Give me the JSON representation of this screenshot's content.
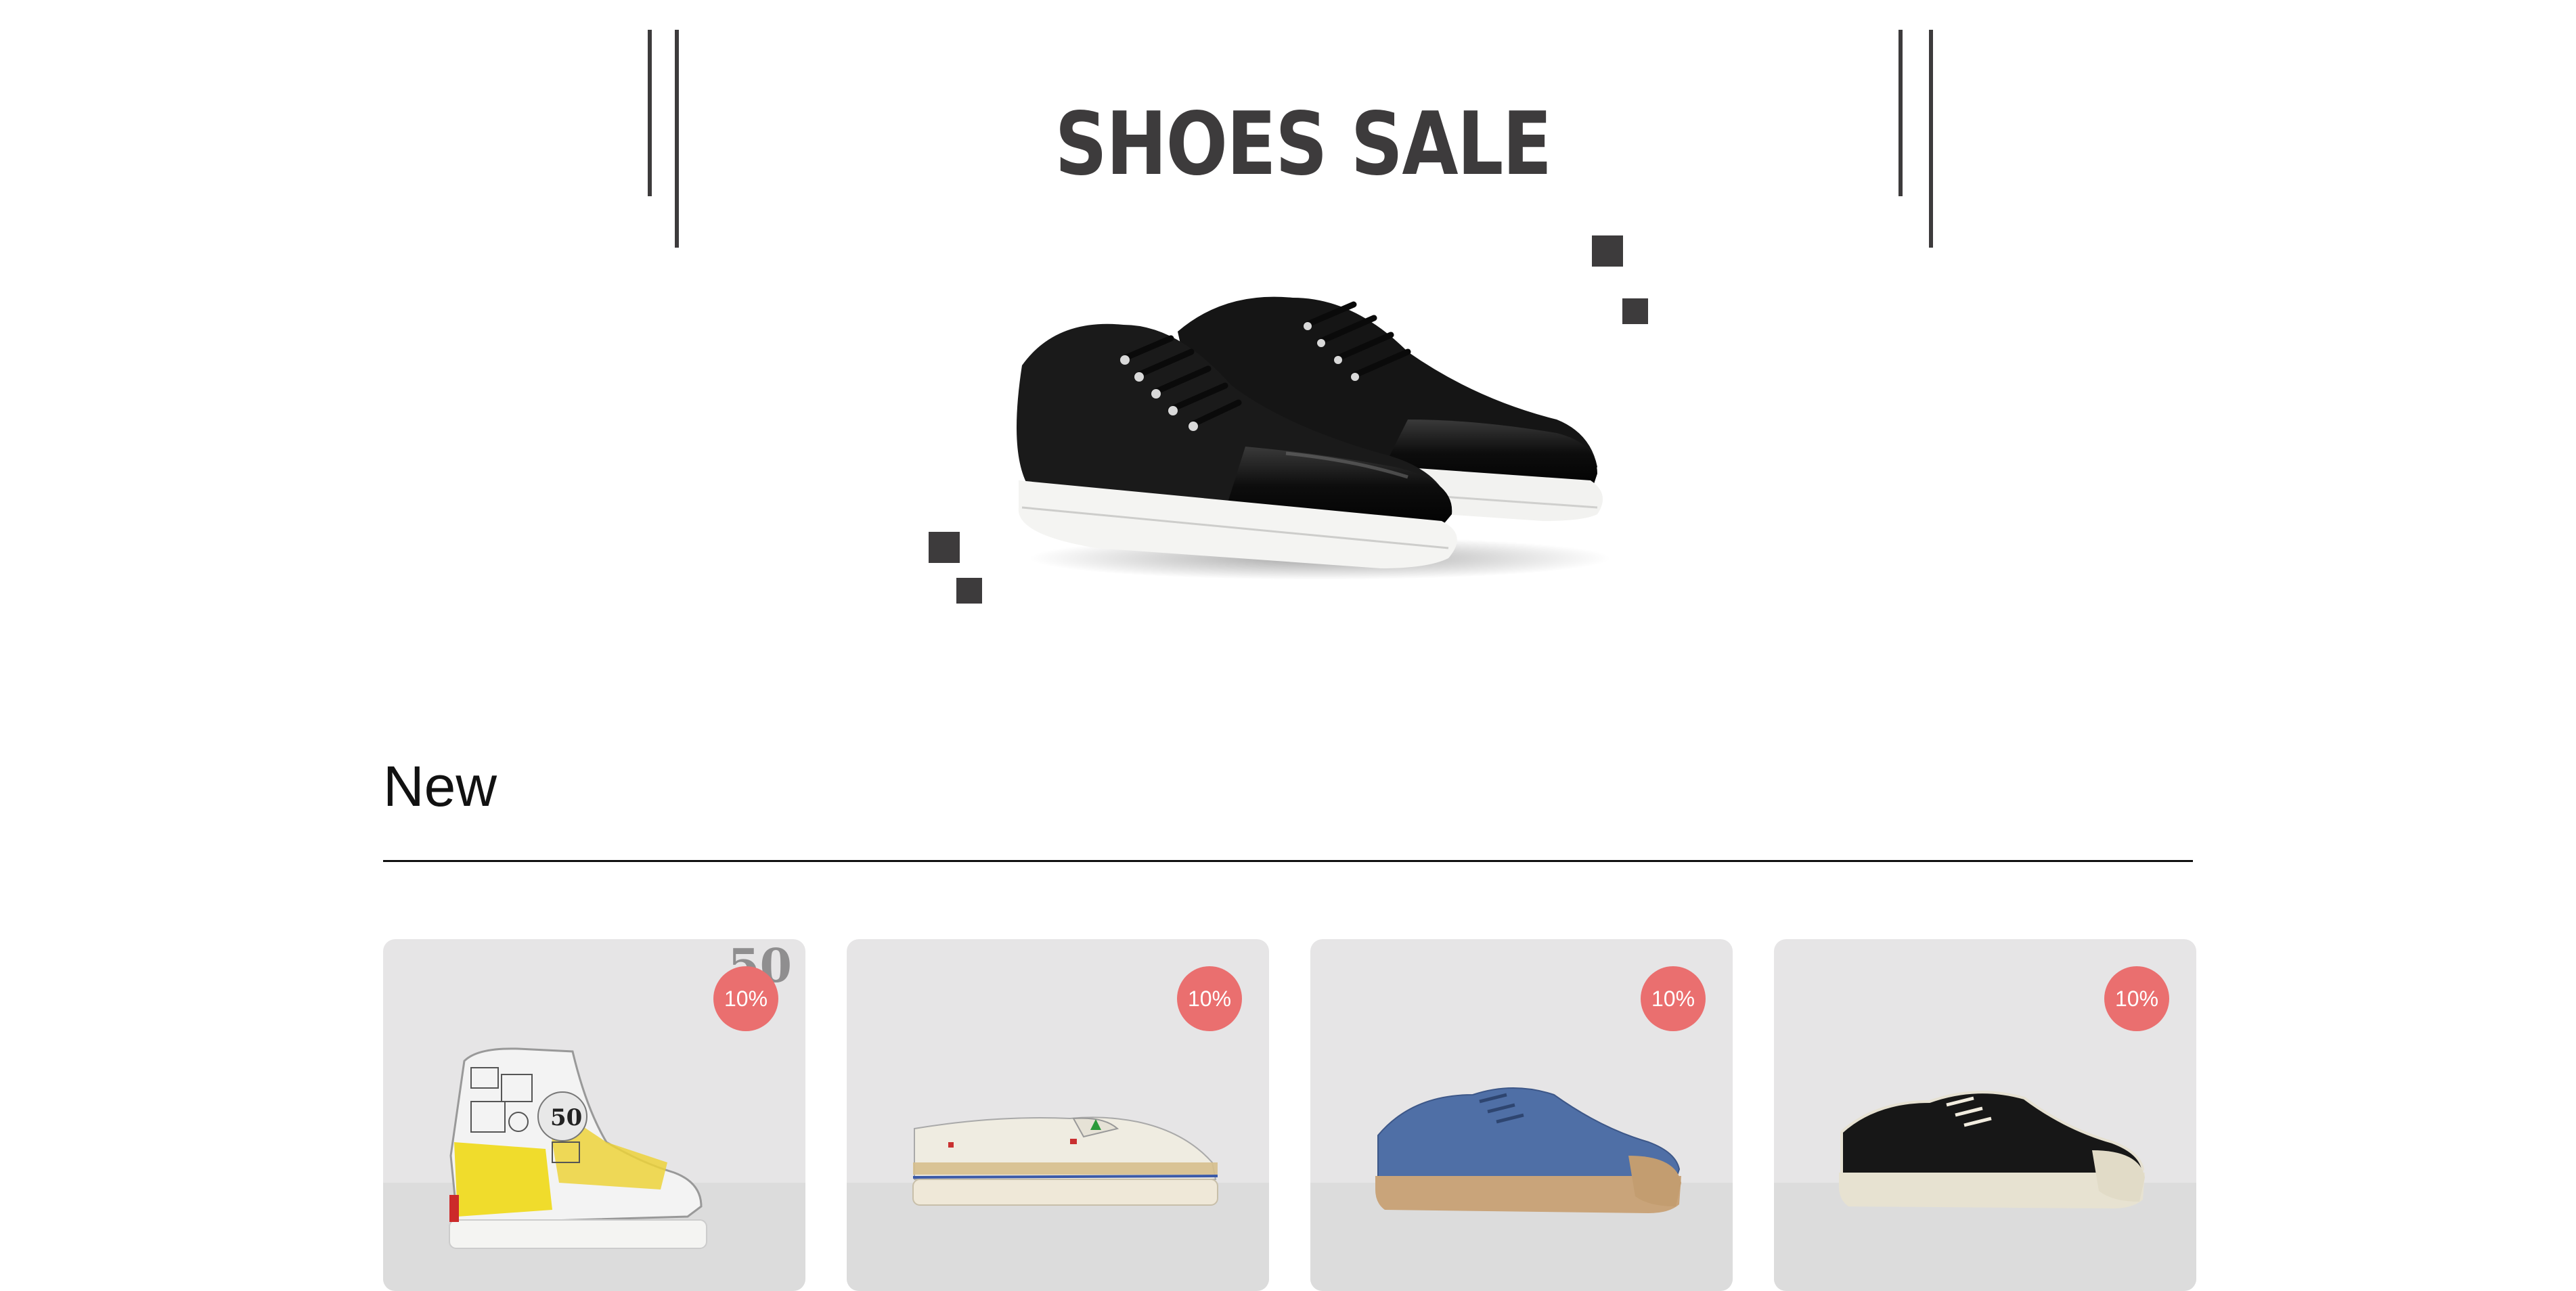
{
  "hero": {
    "title": "SHOES SALE",
    "shoe_icon": "black-suede-patent-sneaker"
  },
  "section": {
    "title": "New"
  },
  "products": [
    {
      "badge": "10%",
      "deco": "50",
      "image_icon": "yellow-comic-print-high-top-sneaker"
    },
    {
      "badge": "10%",
      "image_icon": "cream-espadrille-slip-on"
    },
    {
      "badge": "10%",
      "image_icon": "blue-canvas-low-top-gum-sole"
    },
    {
      "badge": "10%",
      "image_icon": "black-canvas-low-top-cream-sole"
    }
  ],
  "colors": {
    "accent_dark": "#3d3b3c",
    "badge_red": "#ea6f6f",
    "card_bg": "#e6e5e6"
  }
}
